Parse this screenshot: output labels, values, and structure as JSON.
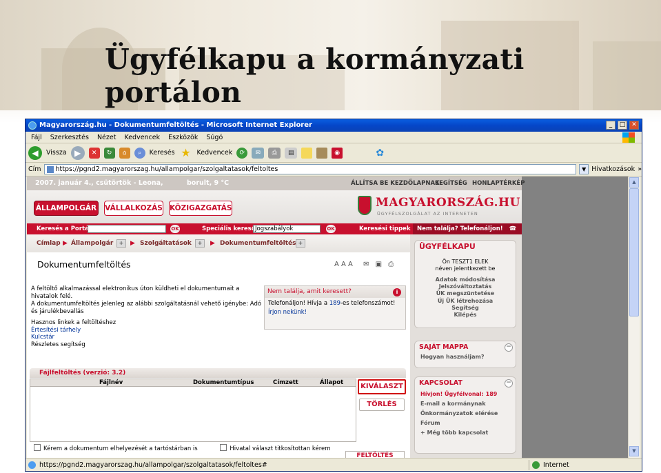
{
  "slide": {
    "title": "Ügyfélkapu a kormányzati portálon"
  },
  "browser": {
    "window_title": "Magyarország.hu - Dokumentumfeltöltés - Microsoft Internet Explorer",
    "menu": [
      "Fájl",
      "Szerkesztés",
      "Nézet",
      "Kedvencek",
      "Eszközök",
      "Súgó"
    ],
    "toolbar": {
      "back": "Vissza",
      "search": "Keresés",
      "favorites": "Kedvencek"
    },
    "address_label": "Cím",
    "address": "https://pgnd2.magyarorszag.hu/allampolgar/szolgaltatasok/feltoltes",
    "links_label": "Hivatkozások",
    "status_url": "https://pgnd2.magyarorszag.hu/allampolgar/szolgaltatasok/feltoltes#",
    "status_zone": "Internet"
  },
  "site": {
    "date": "2007. január 4., csütörtök - Leona,",
    "weather": "borult, 9 °C",
    "top_links": [
      "ÁLLÍTSA BE KEZDŐLAPNAK",
      "SEGÍTSÉG",
      "HONLAPTÉRKÉP"
    ],
    "tabs": [
      "ÁLLAMPOLGÁR",
      "VÁLLALKOZÁS",
      "KÖZIGAZGATÁS"
    ],
    "logo_name": "MAGYARORSZÁG.HU",
    "logo_sub": "ÜGYFÉLSZOLGÁLAT AZ INTERNETEN",
    "search": {
      "portal_label": "Keresés a Portálon:",
      "special_label": "Speciális keresők:",
      "special_value": "Jogszabályok",
      "ok": "OK",
      "tips": "Keresési tippek",
      "not_found": "Nem találja? Telefonáljon!",
      "phone": "☎ 189"
    },
    "breadcrumb": [
      "Címlap",
      "Állampolgár",
      "Szolgáltatások",
      "Dokumentumfeltöltés"
    ],
    "page_title": "Dokumentumfeltöltés",
    "font_sizer": "A A A",
    "intro": [
      "A feltöltő alkalmazással elektronikus úton küldheti el dokumentumait a hivatalok felé.",
      "A dokumentumfeltöltés jelenleg az alábbi szolgáltatásnál vehető igénybe: Adó és járulékbevallás"
    ],
    "useful_links_title": "Hasznos linkek a feltöltéshez",
    "useful_links": [
      "Értesítési tárhely",
      "Kulcstár"
    ],
    "detailed_help": "Részletes segítség",
    "help_box": {
      "title": "Nem találja, amit keresett?",
      "text_before": "Telefonáljon! Hívja a ",
      "number": "189",
      "text_after": "-es telefonszámot!",
      "link": "Írjon nekünk!"
    },
    "upload": {
      "title": "Fájlfeltöltés (verzió: 3.2)",
      "columns": [
        "Fájlnév",
        "Dokumentumtípus",
        "Címzett",
        "Állapot"
      ],
      "btn_select": "KIVÁLASZT",
      "btn_delete": "TÖRLÉS",
      "btn_upload": "FELTÖLTÉS",
      "check1": "Kérem a dokumentum elhelyezését a tartóstárban is",
      "check2": "Hivatal választ titkosítottan kérem"
    },
    "sidebar": {
      "ugyfelkapu_title": "ÜGYFÉLKAPU",
      "login_line1": "Ön TESZT1 ELEK",
      "login_line2": "néven jelentkezett be",
      "menu": [
        "Adatok módosítása",
        "Jelszóváltoztatás",
        "ÜK megszüntetése",
        "Új ÜK létrehozása",
        "Segítség",
        "Kilépés"
      ],
      "mappa_title": "SAJÁT MAPPA",
      "mappa_item": "Hogyan használjam?",
      "kapcs_title": "KAPCSOLAT",
      "kapcs_items": [
        "Hívjon! Ügyfélvonal: 189",
        "E-mail a kormánynak",
        "Önkormányzatok elérése",
        "Fórum",
        "+ Még több kapcsolat"
      ]
    }
  },
  "colors": {
    "brand_red": "#c8102e",
    "xp_blue": "#0a5ee0"
  }
}
